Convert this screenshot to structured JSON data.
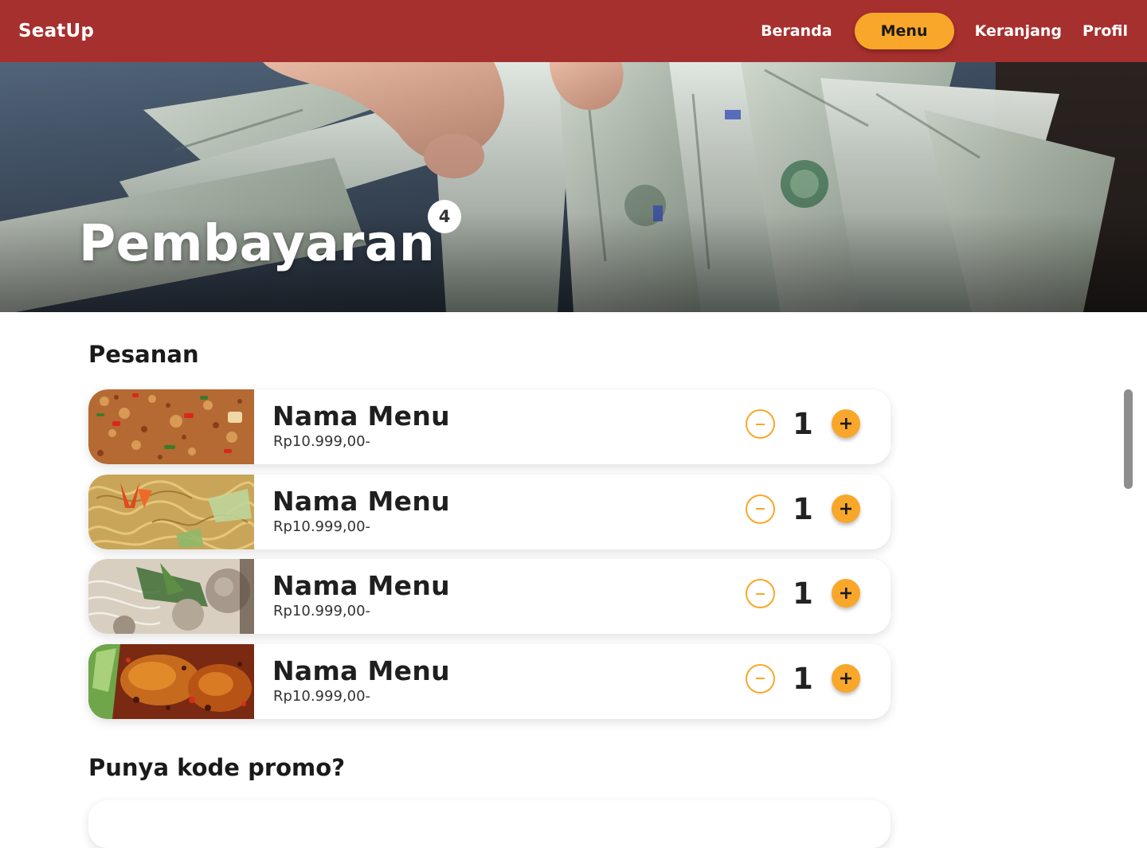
{
  "brand": "SeatUp",
  "nav": {
    "items": [
      {
        "label": "Beranda",
        "active": false
      },
      {
        "label": "Menu",
        "active": true
      },
      {
        "label": "Keranjang",
        "active": false
      },
      {
        "label": "Profil",
        "active": false
      }
    ]
  },
  "hero": {
    "title": "Pembayaran",
    "badge_count": "4"
  },
  "orders": {
    "title": "Pesanan",
    "items": [
      {
        "name": "Nama Menu",
        "price": "Rp10.999,00-",
        "qty": "1",
        "image": "fried-rice"
      },
      {
        "name": "Nama Menu",
        "price": "Rp10.999,00-",
        "qty": "1",
        "image": "fried-noodles"
      },
      {
        "name": "Nama Menu",
        "price": "Rp10.999,00-",
        "qty": "1",
        "image": "meatball-soup"
      },
      {
        "name": "Nama Menu",
        "price": "Rp10.999,00-",
        "qty": "1",
        "image": "fried-chicken"
      }
    ]
  },
  "promo": {
    "title": "Punya kode promo?"
  },
  "colors": {
    "navbar": "#a6302e",
    "accent": "#f9a72a"
  }
}
